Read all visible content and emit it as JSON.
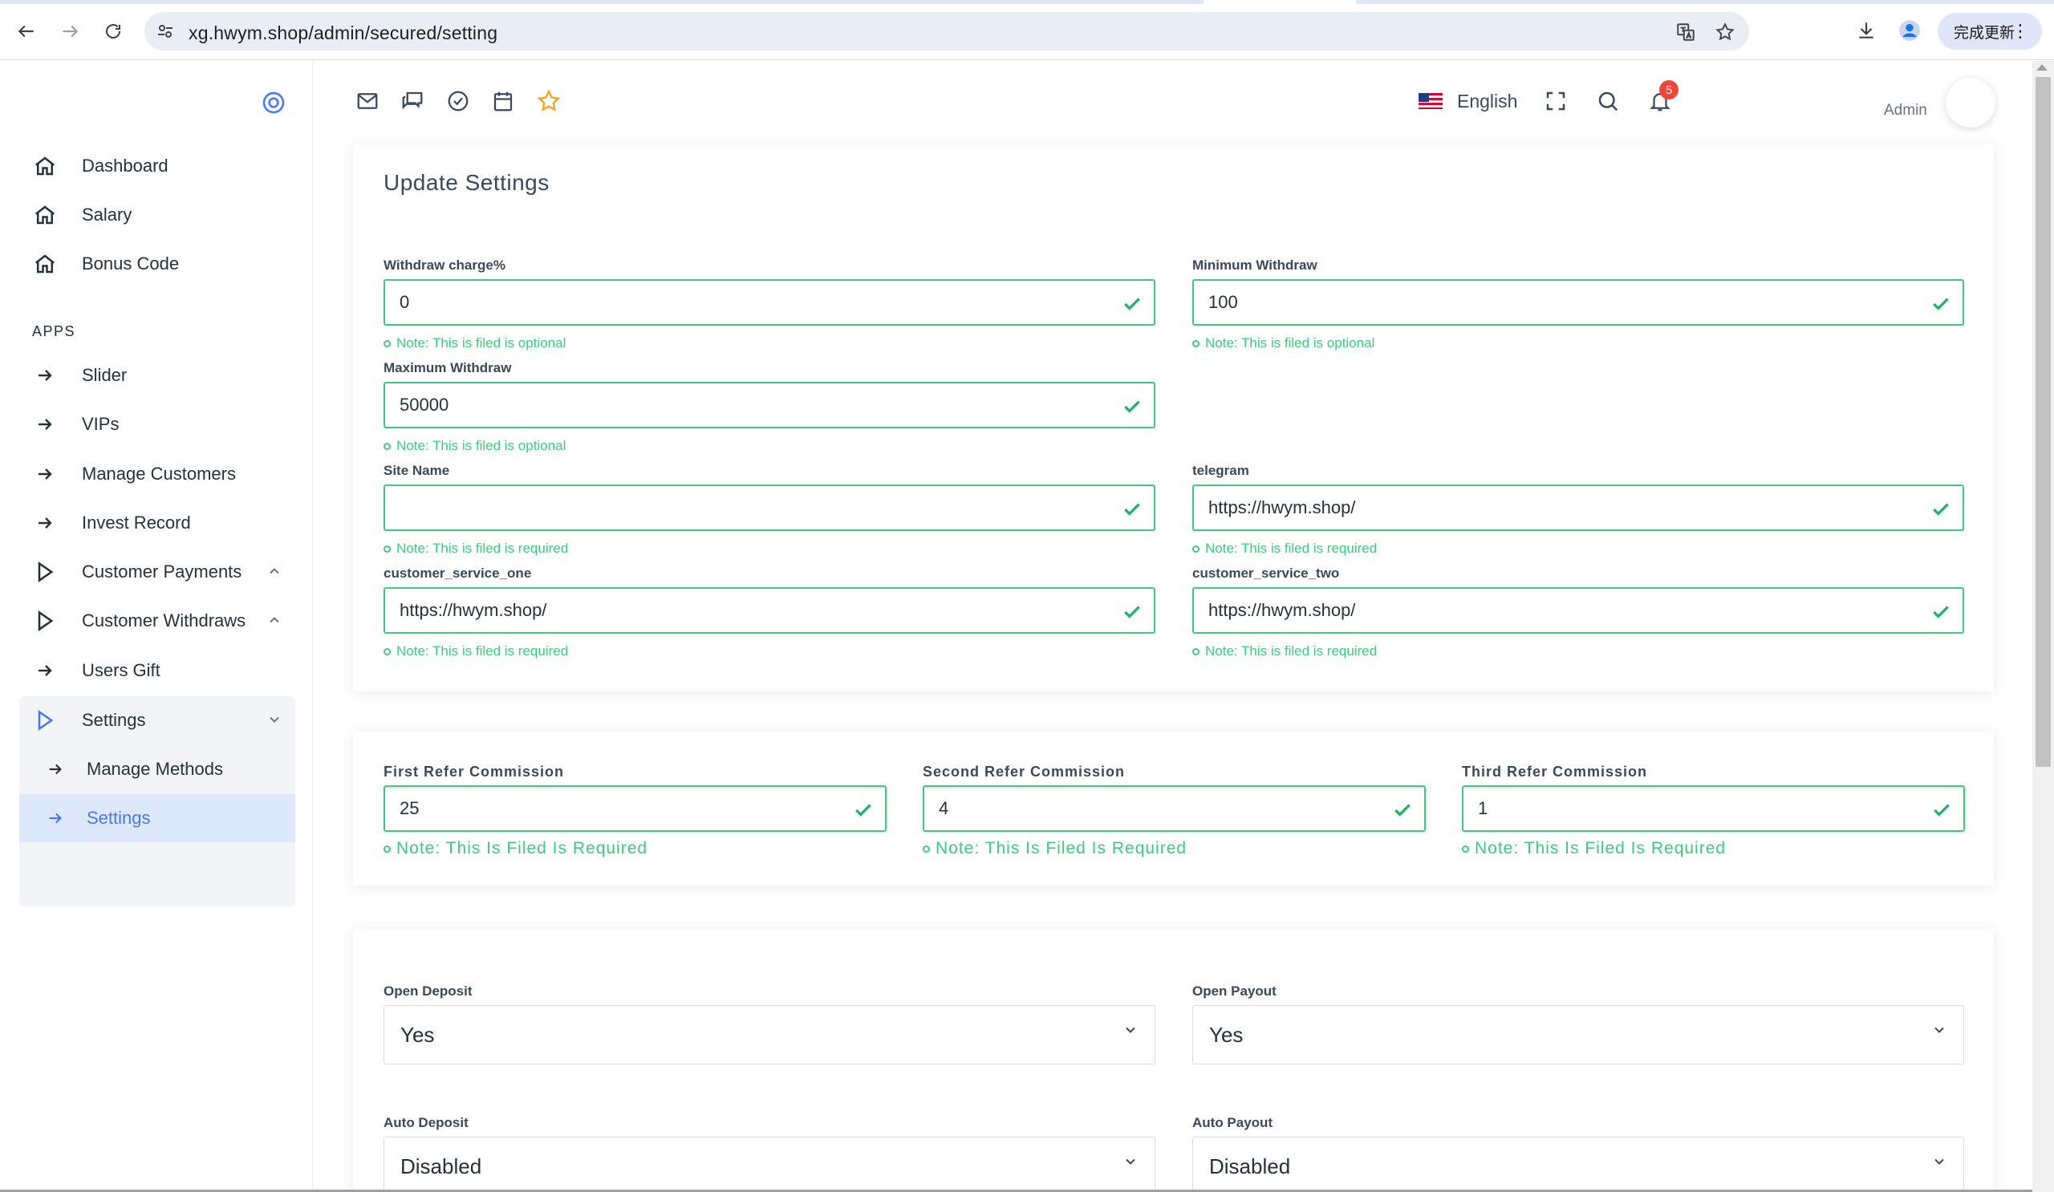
{
  "browser": {
    "url": "xg.hwym.shop/admin/secured/setting",
    "update_label": "完成更新"
  },
  "sidebar": {
    "main_items": [
      {
        "label": "Dashboard",
        "icon": "home-icon"
      },
      {
        "label": "Salary",
        "icon": "home-icon"
      },
      {
        "label": "Bonus Code",
        "icon": "home-icon"
      }
    ],
    "apps_heading": "APPS",
    "app_items": [
      {
        "label": "Slider",
        "icon": "arrow-right-icon"
      },
      {
        "label": "VIPs",
        "icon": "arrow-right-icon"
      },
      {
        "label": "Manage Customers",
        "icon": "arrow-right-icon"
      },
      {
        "label": "Invest Record",
        "icon": "arrow-right-icon"
      },
      {
        "label": "Customer Payments",
        "icon": "play-icon"
      },
      {
        "label": "Customer Withdraws",
        "icon": "play-icon"
      },
      {
        "label": "Users Gift",
        "icon": "arrow-right-icon"
      },
      {
        "label": "Settings",
        "icon": "play-icon"
      }
    ],
    "settings_sub": [
      {
        "label": "Manage Methods"
      },
      {
        "label": "Settings"
      }
    ]
  },
  "topbar": {
    "language": "English",
    "notification_count": "5",
    "user_label": "Admin"
  },
  "settings_card": {
    "title": "Update Settings",
    "fields": [
      {
        "label": "Withdraw charge%",
        "value": "0",
        "note": "Note: This is filed is optional"
      },
      {
        "label": "Minimum Withdraw",
        "value": "100",
        "note": "Note: This is filed is optional"
      },
      {
        "label": "Maximum Withdraw",
        "value": "50000",
        "note": "Note: This is filed is optional"
      },
      {
        "label": "Site Name",
        "value": "",
        "note": "Note: This is filed is required"
      },
      {
        "label": "telegram",
        "value": "https://hwym.shop/",
        "note": "Note: This is filed is required"
      },
      {
        "label": "customer_service_one",
        "value": "https://hwym.shop/",
        "note": "Note: This is filed is required"
      },
      {
        "label": "customer_service_two",
        "value": "https://hwym.shop/",
        "note": "Note: This is filed is required"
      }
    ]
  },
  "commission_card": {
    "fields": [
      {
        "label": "First Refer Commission",
        "value": "25",
        "note": "Note: This Is Filed Is Required"
      },
      {
        "label": "Second Refer Commission",
        "value": "4",
        "note": "Note: This Is Filed Is Required"
      },
      {
        "label": "Third Refer Commission",
        "value": "1",
        "note": "Note: This Is Filed Is Required"
      }
    ]
  },
  "switch_card": {
    "fields": [
      {
        "label": "Open Deposit",
        "value": "Yes"
      },
      {
        "label": "Open Payout",
        "value": "Yes"
      },
      {
        "label": "Auto Deposit",
        "value": "Disabled"
      },
      {
        "label": "Auto Payout",
        "value": "Disabled"
      }
    ]
  },
  "colors": {
    "accent": "#4a7ae8",
    "success": "#3ecb7f",
    "badge": "#f0453a"
  }
}
